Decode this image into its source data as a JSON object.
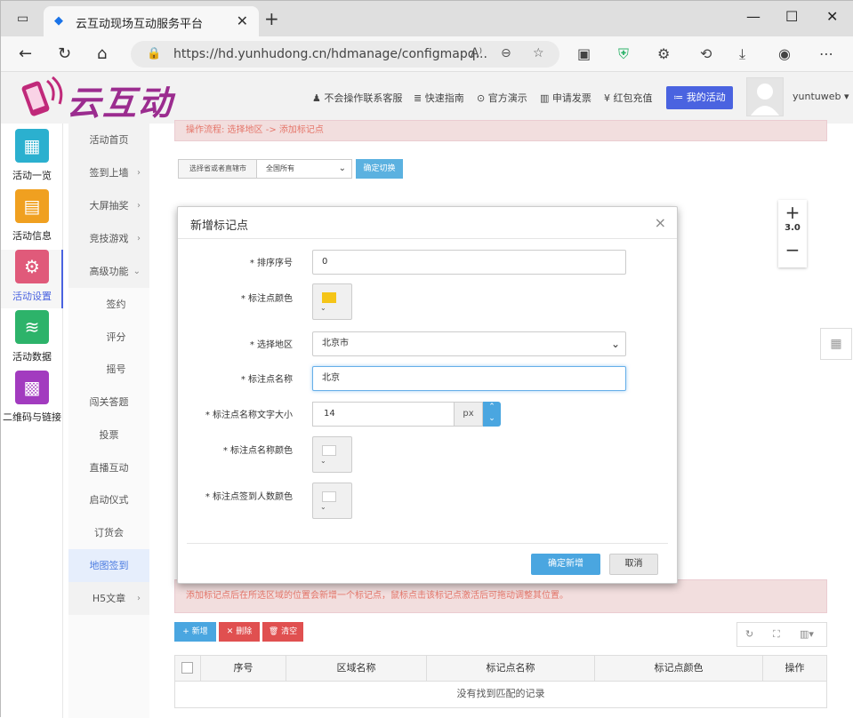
{
  "browser": {
    "tab_title": "云互动现场互动服务平台",
    "url": "https://hd.yunhudong.cn/hdmanage/configmapq..."
  },
  "header": {
    "logo_text": "云互动",
    "nav": [
      "不会操作联系客服",
      "快速指南",
      "官方演示",
      "申请发票",
      "红包充值"
    ],
    "my_activity": "我的活动",
    "username": "yuntuweb"
  },
  "leftbar": [
    {
      "label": "活动一览",
      "icon": "grid-icon",
      "color": "#2bb0cf"
    },
    {
      "label": "活动信息",
      "icon": "document-icon",
      "color": "#f0a020"
    },
    {
      "label": "活动设置",
      "icon": "gear-icon",
      "color": "#e05a7a"
    },
    {
      "label": "活动数据",
      "icon": "database-icon",
      "color": "#2db36a"
    },
    {
      "label": "二维码与链接",
      "icon": "qrcode-icon",
      "color": "#a23bbf"
    }
  ],
  "submenu": [
    {
      "label": "活动首页",
      "arrow": ""
    },
    {
      "label": "签到上墙",
      "arrow": "›"
    },
    {
      "label": "大屏抽奖",
      "arrow": "›"
    },
    {
      "label": "竞技游戏",
      "arrow": "›"
    },
    {
      "label": "高级功能",
      "arrow": "⌄"
    },
    {
      "label": "签约",
      "arrow": ""
    },
    {
      "label": "评分",
      "arrow": ""
    },
    {
      "label": "摇号",
      "arrow": ""
    },
    {
      "label": "闯关答题",
      "arrow": ""
    },
    {
      "label": "投票",
      "arrow": ""
    },
    {
      "label": "直播互动",
      "arrow": ""
    },
    {
      "label": "启动仪式",
      "arrow": ""
    },
    {
      "label": "订货会",
      "arrow": ""
    },
    {
      "label": "地图签到",
      "arrow": ""
    },
    {
      "label": "H5文章",
      "arrow": "›"
    }
  ],
  "main": {
    "alert_top": "操作流程: 选择地区 -> 添加标记点",
    "region_select_label": "选择省或者直辖市",
    "region_select_value": "全国所有",
    "confirm_switch": "确定切换",
    "zoom_value": "3.0",
    "alert_bottom": "添加标记点后在所选区域的位置会新增一个标记点，鼠标点击该标记点激活后可拖动调整其位置。",
    "add_btn": "+ 新增",
    "delete_btn": "✕ 删除",
    "clear_btn": "🗑 清空",
    "table_headers": [
      "序号",
      "区域名称",
      "标记点名称",
      "标记点颜色",
      "操作"
    ],
    "empty_text": "没有找到匹配的记录"
  },
  "modal": {
    "title": "新增标记点",
    "fields": {
      "order_label": "* 排序序号",
      "order_value": "0",
      "color_label": "* 标注点颜色",
      "color_value": "#f5c518",
      "region_label": "* 选择地区",
      "region_value": "北京市",
      "name_label": "* 标注点名称",
      "name_value": "北京",
      "fontsize_label": "* 标注点名称文字大小",
      "fontsize_value": "14",
      "fontsize_unit": "px",
      "namecolor_label": "* 标注点名称颜色",
      "namecolor_value": "#ffffff",
      "countcolor_label": "* 标注点签到人数颜色",
      "countcolor_value": "#ffffff"
    },
    "ok": "确定新增",
    "cancel": "取消"
  }
}
